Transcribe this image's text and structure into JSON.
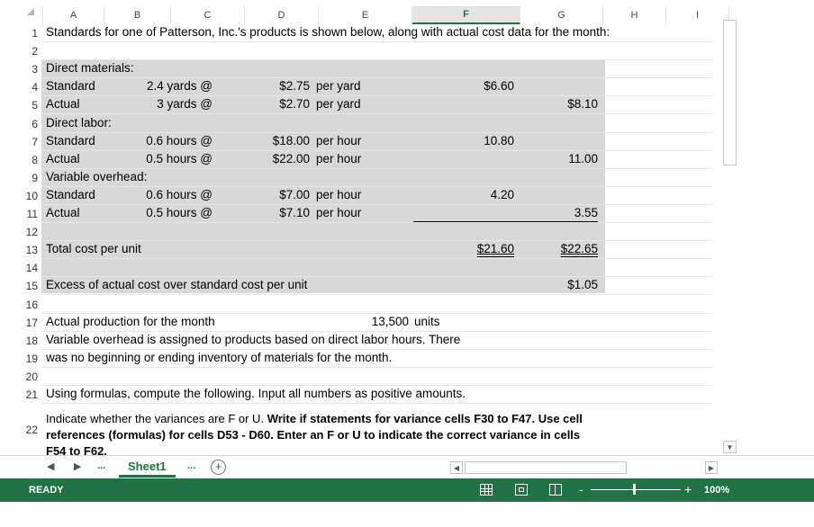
{
  "columns": [
    "A",
    "B",
    "C",
    "D",
    "E",
    "F",
    "G",
    "H",
    "I"
  ],
  "active_column": "F",
  "rows": [
    {
      "n": "1",
      "cells": [
        {
          "col": "a",
          "text": "Standards for one of Patterson, Inc.'s products is shown below, along with actual cost data for the month:"
        }
      ]
    },
    {
      "n": "2",
      "cells": []
    },
    {
      "n": "3",
      "cells": [
        {
          "col": "a",
          "text": "Direct materials:"
        }
      ]
    },
    {
      "n": "4",
      "cells": [
        {
          "col": "a",
          "text": "Standard"
        },
        {
          "col": "c",
          "text": "2.4 yards @"
        },
        {
          "col": "d",
          "text": "$2.75"
        },
        {
          "col": "e",
          "text": "per yard"
        },
        {
          "col": "f",
          "text": "$6.60"
        }
      ]
    },
    {
      "n": "5",
      "cells": [
        {
          "col": "a",
          "text": "Actual"
        },
        {
          "col": "c",
          "text": "3 yards @"
        },
        {
          "col": "d",
          "text": "$2.70"
        },
        {
          "col": "e",
          "text": "per yard"
        },
        {
          "col": "g",
          "text": "$8.10"
        }
      ]
    },
    {
      "n": "6",
      "cells": [
        {
          "col": "a",
          "text": "Direct labor:"
        }
      ]
    },
    {
      "n": "7",
      "cells": [
        {
          "col": "a",
          "text": "Standard"
        },
        {
          "col": "c",
          "text": "0.6 hours @"
        },
        {
          "col": "d",
          "text": "$18.00"
        },
        {
          "col": "e",
          "text": "per hour"
        },
        {
          "col": "f",
          "text": "10.80"
        }
      ]
    },
    {
      "n": "8",
      "cells": [
        {
          "col": "a",
          "text": "Actual"
        },
        {
          "col": "c",
          "text": "0.5 hours @"
        },
        {
          "col": "d",
          "text": "$22.00"
        },
        {
          "col": "e",
          "text": "per hour"
        },
        {
          "col": "g",
          "text": "11.00"
        }
      ]
    },
    {
      "n": "9",
      "cells": [
        {
          "col": "a",
          "text": "Variable overhead:"
        }
      ]
    },
    {
      "n": "10",
      "cells": [
        {
          "col": "a",
          "text": "Standard"
        },
        {
          "col": "c",
          "text": "0.6 hours @"
        },
        {
          "col": "d",
          "text": "$7.00"
        },
        {
          "col": "e",
          "text": "per hour"
        },
        {
          "col": "f",
          "text": "4.20"
        }
      ]
    },
    {
      "n": "11",
      "cells": [
        {
          "col": "a",
          "text": "Actual"
        },
        {
          "col": "c",
          "text": "0.5 hours @"
        },
        {
          "col": "d",
          "text": "$7.10"
        },
        {
          "col": "e",
          "text": "per hour"
        },
        {
          "col": "g",
          "text": "3.55"
        }
      ]
    },
    {
      "n": "12",
      "cells": []
    },
    {
      "n": "13",
      "cells": [
        {
          "col": "a",
          "text": "Total cost per unit"
        },
        {
          "col": "f",
          "text": "$21.60"
        },
        {
          "col": "g",
          "text": "$22.65"
        }
      ]
    },
    {
      "n": "14",
      "cells": []
    },
    {
      "n": "15",
      "cells": [
        {
          "col": "a",
          "text": "Excess of actual cost over standard cost per unit"
        },
        {
          "col": "g",
          "text": "$1.05"
        }
      ]
    },
    {
      "n": "16",
      "cells": []
    },
    {
      "n": "17",
      "cells": [
        {
          "col": "a",
          "text": "Actual production for the month"
        },
        {
          "col": "d2",
          "text": "13,500"
        },
        {
          "col": "e2",
          "text": "units"
        }
      ]
    },
    {
      "n": "18",
      "cells": [
        {
          "col": "a",
          "text": "Variable overhead is assigned to products based on direct labor hours. There"
        }
      ]
    },
    {
      "n": "19",
      "cells": [
        {
          "col": "a",
          "text": "was no beginning or ending inventory of materials for the month."
        }
      ]
    },
    {
      "n": "20",
      "cells": []
    },
    {
      "n": "21",
      "cells": [
        {
          "col": "a",
          "text": "Using formulas, compute the following.  Input all numbers as positive amounts."
        }
      ]
    }
  ],
  "row22": {
    "n": "22",
    "line1_normal": "Indicate whether the variances are F or U. ",
    "line1_bold": "Write if statements for variance cells F30 to F47. Use cell",
    "line2_bold": "references (formulas) for cells D53 - D60. Enter an  F or U to indicate the correct variance in cells",
    "line3_bold": "F54 to F62."
  },
  "tabs": {
    "prev_icon": "◀",
    "next_icon": "▶",
    "ellipsis_left": "...",
    "active_sheet": "Sheet1",
    "ellipsis_right": "...",
    "add_icon": "+"
  },
  "status": {
    "text": "READY",
    "zoom_minus": "-",
    "zoom_plus": "+",
    "zoom_level": "100%"
  },
  "colors": {
    "accent": "#217346",
    "shade": "#d8d8d8"
  }
}
